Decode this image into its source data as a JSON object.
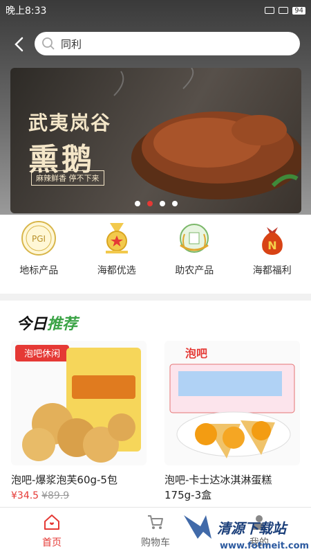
{
  "status": {
    "time": "晚上8:33",
    "battery": "94"
  },
  "search": {
    "value": "同利"
  },
  "banner": {
    "title_line1": "武夷岚谷",
    "title_line2": "熏鹅",
    "tagline": "麻辣鲜香 停不下来"
  },
  "categories": [
    {
      "label": "地标产品",
      "icon": "pgi-badge-icon"
    },
    {
      "label": "海都优选",
      "icon": "medal-icon"
    },
    {
      "label": "助农产品",
      "icon": "farm-icon"
    },
    {
      "label": "海都福利",
      "icon": "money-bag-icon"
    }
  ],
  "recommend": {
    "title_a": "今日",
    "title_b": "推荐"
  },
  "products": [
    {
      "brand": "泡吧休闲",
      "name": "泡吧-爆浆泡芙60g-5包",
      "price": "¥34.5",
      "old_price": "¥89.9"
    },
    {
      "brand": "泡吧",
      "name": "泡吧-卡士达冰淇淋蛋糕175g-3盒",
      "price": "",
      "old_price": ""
    }
  ],
  "tabs": [
    {
      "label": "首页",
      "icon": "home-icon",
      "active": true
    },
    {
      "label": "购物车",
      "icon": "cart-icon",
      "active": false
    },
    {
      "label": "我的",
      "icon": "user-icon",
      "active": false
    }
  ],
  "watermark": {
    "text": "清源下载站",
    "url": "www.fotmeit.com"
  },
  "colors": {
    "accent": "#e53935",
    "green": "#3aa345"
  }
}
